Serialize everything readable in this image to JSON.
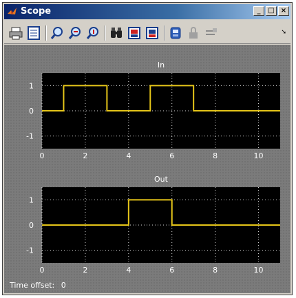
{
  "window": {
    "title": "Scope"
  },
  "title_buttons": {
    "minimize": "_",
    "maximize": "□",
    "close": "×"
  },
  "toolbar": {
    "icons": [
      "print-icon",
      "parameters-icon",
      "zoom-icon",
      "zoom-x-icon",
      "zoom-y-icon",
      "autoscale-binoculars-icon",
      "save-axes-icon",
      "restore-axes-icon",
      "floating-scope-icon",
      "lock-icon",
      "signal-selection-icon"
    ]
  },
  "status": {
    "label": "Time offset:",
    "value": "0"
  },
  "colors": {
    "plot_bg": "#000000",
    "trace": "#e6c619",
    "grid": "#ffffff",
    "frame": "#7b7b7b"
  },
  "chart_data": [
    {
      "type": "line",
      "title": "In",
      "xlim": [
        0,
        11
      ],
      "ylim": [
        -1.5,
        1.5
      ],
      "xticks": [
        0,
        2,
        4,
        6,
        8,
        10
      ],
      "yticks": [
        1,
        0,
        -1
      ],
      "grid": true,
      "series": [
        {
          "x": [
            0,
            1,
            1,
            3,
            3,
            5,
            5,
            7,
            7,
            11
          ],
          "y": [
            0,
            0,
            1,
            1,
            0,
            0,
            1,
            1,
            0,
            0
          ]
        }
      ]
    },
    {
      "type": "line",
      "title": "Out",
      "xlim": [
        0,
        11
      ],
      "ylim": [
        -1.5,
        1.5
      ],
      "xticks": [
        0,
        2,
        4,
        6,
        8,
        10
      ],
      "yticks": [
        1,
        0,
        -1
      ],
      "grid": true,
      "series": [
        {
          "x": [
            0,
            4,
            4,
            6,
            6,
            11
          ],
          "y": [
            0,
            0,
            1,
            1,
            0,
            0
          ]
        }
      ]
    }
  ]
}
